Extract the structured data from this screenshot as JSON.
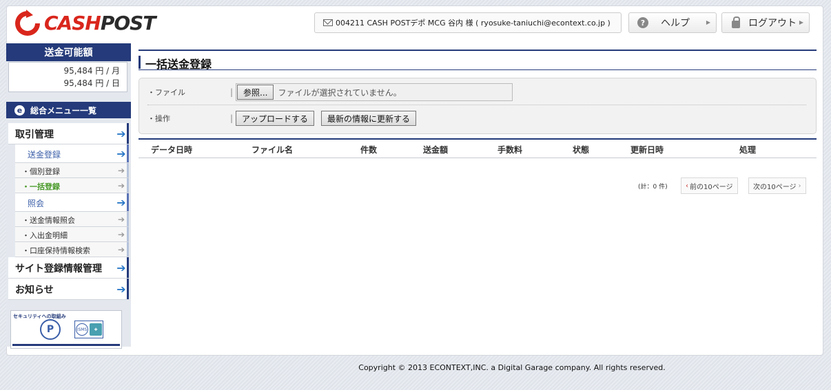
{
  "brand": {
    "logo_part1": "CASH",
    "logo_part2": "POST",
    "accent": "#d9261c",
    "navy": "#243a7a"
  },
  "header": {
    "user_info": "004211 CASH  POSTデポ MCG  谷内 様 ( ryosuke-taniuchi@econtext.co.jp )",
    "help_label": "ヘルプ",
    "logout_label": "ログアウト",
    "help_icon": "?"
  },
  "sidebar": {
    "limit_title": "送金可能額",
    "limit_month": "95,484 円 / 月",
    "limit_day": "95,484 円 / 日",
    "menu_title": "総合メニュー一覧",
    "menu_icon": "e",
    "items": [
      {
        "label": "取引管理"
      },
      {
        "label": "送金登録"
      },
      {
        "label": "・個別登録"
      },
      {
        "label": "・一括登録"
      },
      {
        "label": "照会"
      },
      {
        "label": "・送金情報照会"
      },
      {
        "label": "・入出金明細"
      },
      {
        "label": "・口座保持情報検索"
      },
      {
        "label": "サイト登録情報管理"
      },
      {
        "label": "お知らせ"
      }
    ],
    "security_title": "セキュリティへの取組み"
  },
  "main": {
    "title": "一括送金登録",
    "file_label": "ファイル",
    "browse_label": "参照...",
    "file_placeholder": "ファイルが選択されていません。",
    "operation_label": "操作",
    "upload_label": "アップロードする",
    "refresh_label": "最新の情報に更新する",
    "columns": [
      "データ日時",
      "ファイル名",
      "件数",
      "送金額",
      "手数料",
      "状態",
      "更新日時",
      "処理"
    ],
    "count_text": "(計：0 件)",
    "prev_label": "前の10ページ",
    "next_label": "次の10ページ"
  },
  "footer": {
    "copyright": "Copyright © 2013 ECONTEXT,INC. a Digital Garage company. All rights reserved."
  }
}
